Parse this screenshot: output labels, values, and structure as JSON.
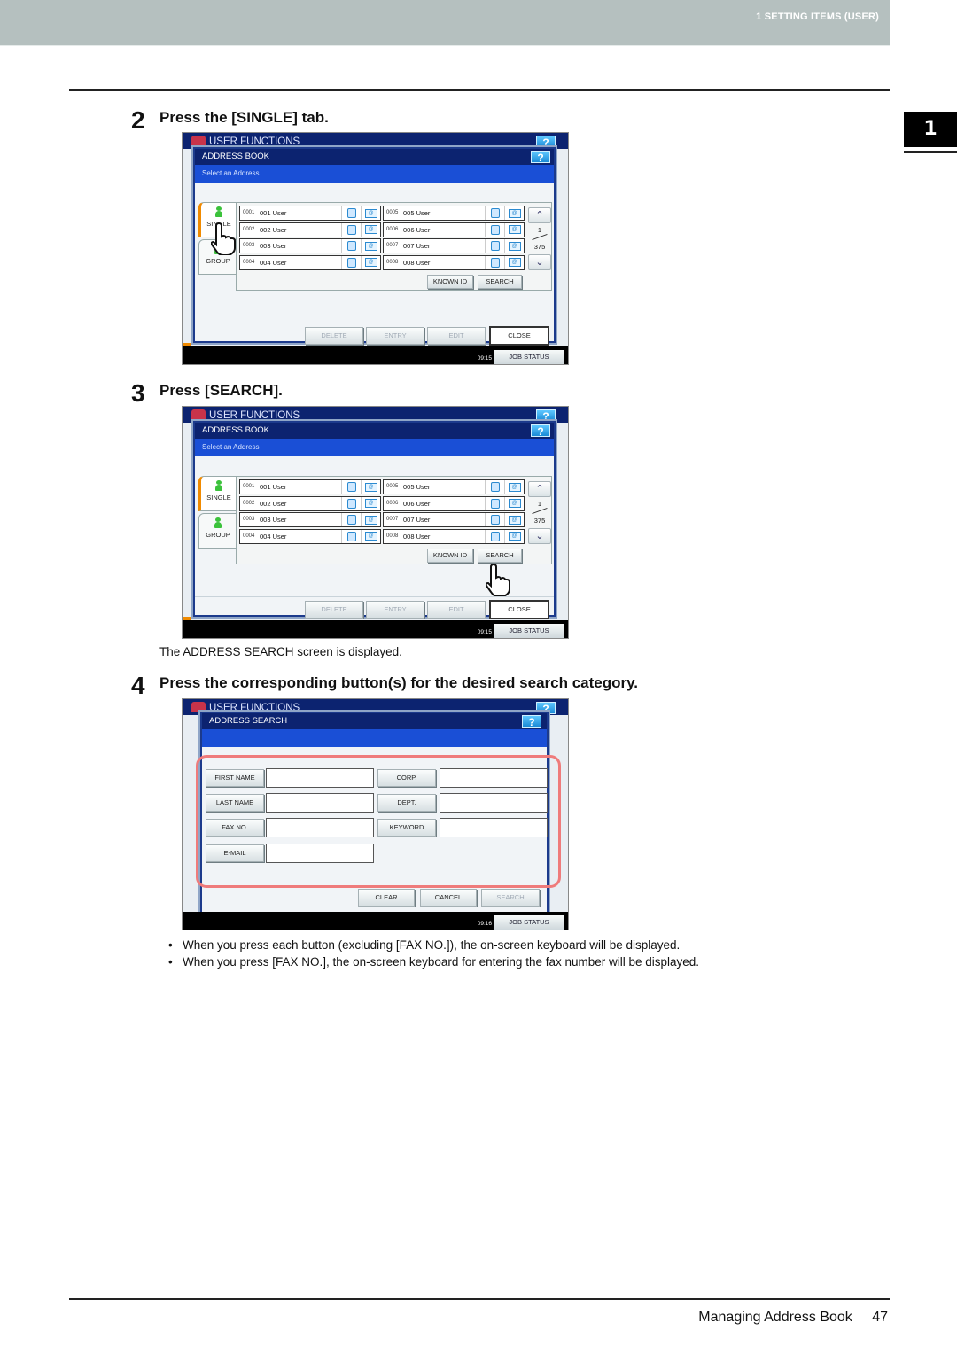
{
  "header": {
    "section": "1 SETTING ITEMS (USER)"
  },
  "chapter_tab": "1",
  "steps": [
    {
      "num": "2",
      "text": "Press the [SINGLE] tab."
    },
    {
      "num": "3",
      "text": "Press [SEARCH]."
    },
    {
      "num": "4",
      "text": "Press the corresponding button(s) for the desired search category."
    }
  ],
  "step3_note": "The ADDRESS SEARCH screen is displayed.",
  "step4_bullets": [
    "When you press each button (excluding [FAX NO.]), the on-screen keyboard will be displayed.",
    "When you press [FAX NO.], the on-screen keyboard for entering the fax number will be displayed."
  ],
  "footer": {
    "title": "Managing Address Book",
    "page": "47"
  },
  "screen_common": {
    "user_functions": "USER FUNCTIONS",
    "help": "?",
    "job_status": "JOB STATUS",
    "icons": {
      "fax": "fax-icon",
      "mail": "email-icon",
      "help": "help-icon"
    }
  },
  "address_book": {
    "title": "ADDRESS BOOK",
    "subtitle": "Select an Address",
    "tabs": {
      "single": "SINGLE",
      "group": "GROUP"
    },
    "entries": [
      {
        "id": "0001",
        "name": "001 User"
      },
      {
        "id": "0002",
        "name": "002 User"
      },
      {
        "id": "0003",
        "name": "003 User"
      },
      {
        "id": "0004",
        "name": "004 User"
      },
      {
        "id": "0005",
        "name": "005 User"
      },
      {
        "id": "0006",
        "name": "006 User"
      },
      {
        "id": "0007",
        "name": "007 User"
      },
      {
        "id": "0008",
        "name": "008 User"
      }
    ],
    "page_current": "1",
    "page_total": "375",
    "known_id": "KNOWN ID",
    "search": "SEARCH",
    "delete": "DELETE",
    "entry": "ENTRY",
    "edit": "EDIT",
    "close": "CLOSE",
    "clock_step2": "09:15",
    "clock_step3": "09:15"
  },
  "address_search": {
    "title": "ADDRESS SEARCH",
    "fields_left": [
      {
        "label": "FIRST NAME",
        "value": ""
      },
      {
        "label": "LAST NAME",
        "value": ""
      },
      {
        "label": "FAX NO.",
        "value": ""
      },
      {
        "label": "E-MAIL",
        "value": ""
      }
    ],
    "fields_right": [
      {
        "label": "CORP.",
        "value": ""
      },
      {
        "label": "DEPT.",
        "value": ""
      },
      {
        "label": "KEYWORD",
        "value": ""
      }
    ],
    "clear": "CLEAR",
    "cancel": "CANCEL",
    "search": "SEARCH",
    "clock": "09:16"
  }
}
